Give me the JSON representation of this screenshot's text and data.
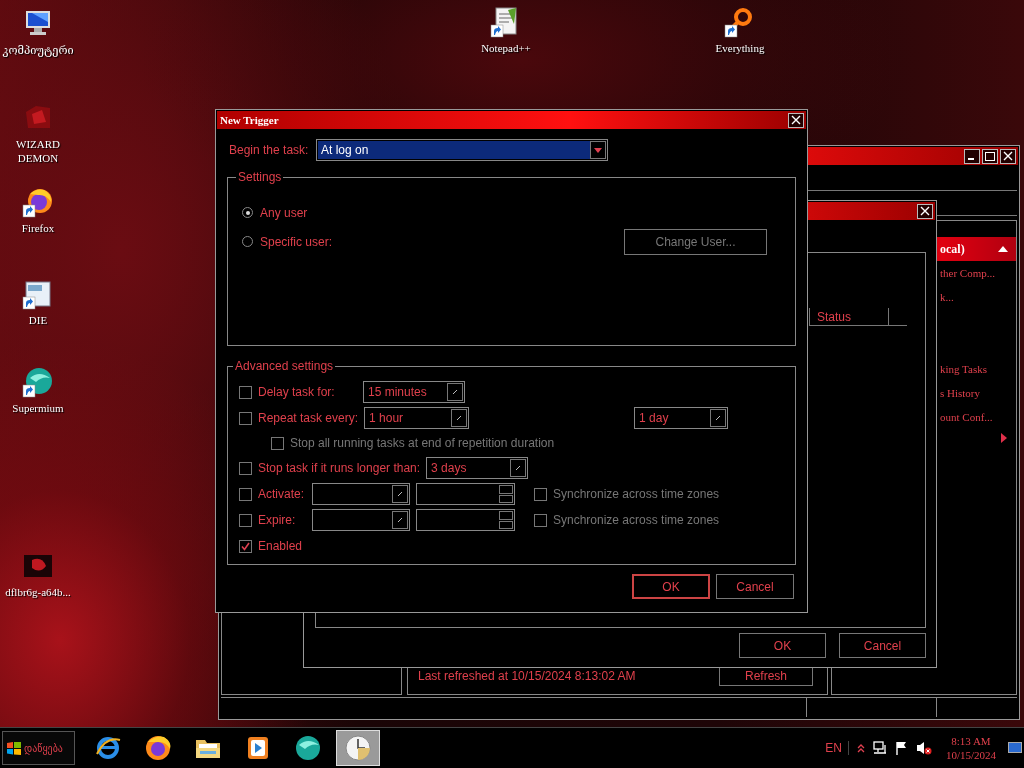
{
  "desktop_icons": [
    {
      "kind": "computer",
      "label": "კომპიუტერი"
    },
    {
      "kind": "wizard",
      "label": "WIZARD DEMON"
    },
    {
      "kind": "firefox",
      "label": "Firefox"
    },
    {
      "kind": "die",
      "label": "DIE"
    },
    {
      "kind": "supermium",
      "label": "Supermium"
    },
    {
      "kind": "image",
      "label": "dflbr6g-a64b..."
    },
    {
      "kind": "notepad",
      "label": "Notepad++"
    },
    {
      "kind": "everything",
      "label": "Everything"
    }
  ],
  "scheduler_window": {
    "actions_header": "ocal)",
    "action_groups": [
      [
        "ther Comp...",
        "k..."
      ],
      [
        "king Tasks",
        "s History",
        "ount Conf..."
      ]
    ],
    "status_text": "Last refreshed at 10/15/2024 8:13:02 AM",
    "refresh_button": "Refresh"
  },
  "create_task_window": {
    "column_header": "Status",
    "buttons": [
      "OK",
      "Cancel"
    ]
  },
  "new_trigger": {
    "title": "New Trigger",
    "begin_label": "Begin the task:",
    "begin_value": "At log on",
    "settings_title": "Settings",
    "user_options": [
      {
        "label": "Any user",
        "selected": true
      },
      {
        "label": "Specific user:",
        "selected": false
      }
    ],
    "change_user": {
      "label": "Change User...",
      "disabled": true
    },
    "advanced_title": "Advanced settings",
    "rows": [
      {
        "kind": "combo",
        "label": "Delay task for:",
        "checked": false,
        "value": "15 minutes"
      },
      {
        "kind": "repeat",
        "label": "Repeat task every:",
        "checked": false,
        "value": "1 hour",
        "duration": "1 day"
      },
      {
        "kind": "sub",
        "label": "Stop all running tasks at end of repetition duration",
        "checked": false,
        "disabled": true
      },
      {
        "kind": "combo",
        "label": "Stop task if it runs longer than:",
        "checked": false,
        "value": "3 days"
      },
      {
        "kind": "datetime",
        "label": "Activate:",
        "checked": false,
        "sync_label": "Synchronize across time zones",
        "sync_checked": false,
        "sync_disabled": true
      },
      {
        "kind": "datetime",
        "label": "Expire:",
        "checked": false,
        "sync_label": "Synchronize across time zones",
        "sync_checked": false,
        "sync_disabled": true
      },
      {
        "kind": "plain",
        "label": "Enabled",
        "checked": true
      }
    ],
    "buttons": [
      {
        "label": "OK",
        "focused": true
      },
      {
        "label": "Cancel",
        "focused": false
      }
    ]
  },
  "taskbar": {
    "start_label": "დაწყება",
    "apps": [
      {
        "kind": "ie",
        "active": false
      },
      {
        "kind": "firefox",
        "active": false
      },
      {
        "kind": "folder",
        "active": false
      },
      {
        "kind": "media",
        "active": false
      },
      {
        "kind": "supermium",
        "active": false
      },
      {
        "kind": "clock",
        "active": true
      }
    ],
    "language": "EN",
    "time": "8:13 AM",
    "date": "10/15/2024"
  }
}
